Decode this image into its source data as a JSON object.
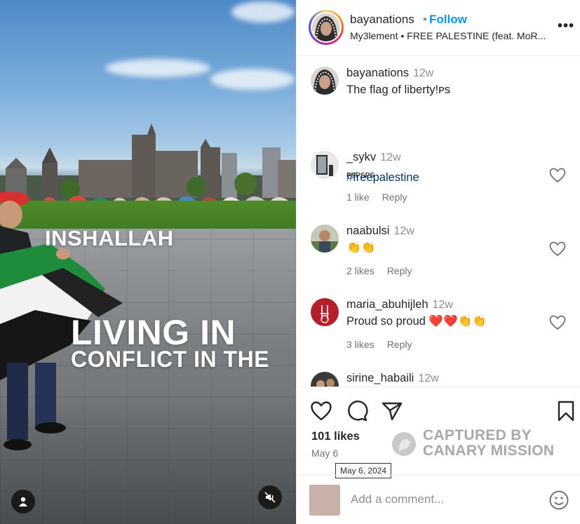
{
  "post": {
    "username": "bayanations",
    "follow_label": "Follow",
    "separator": "•",
    "audio": "My3lement • FREE PALESTINE (feat. MoR...",
    "more_label": "•••"
  },
  "media": {
    "overlay_line1": "INSHALLAH",
    "overlay_line2": "LIVING IN",
    "overlay_line3": "CONFLICT IN THE"
  },
  "caption": {
    "username": "bayanations",
    "time": "12w",
    "text": "The flag of liberty!ᴘs",
    "hashtag": "#freepalestine"
  },
  "comments": [
    {
      "username": "_sykv",
      "time": "12w",
      "text": "ᴘsᴘsᴘs",
      "likes": "1 like",
      "reply": "Reply"
    },
    {
      "username": "naabulsi",
      "time": "12w",
      "text": "👏👏",
      "likes": "2 likes",
      "reply": "Reply"
    },
    {
      "username": "maria_abuhijleh",
      "time": "12w",
      "text": "Proud so proud ❤️❤️👏👏",
      "likes": "3 likes",
      "reply": "Reply"
    },
    {
      "username": "sirine_habaili",
      "time": "12w"
    }
  ],
  "footer": {
    "likes": "101 likes",
    "date": "May 6",
    "tooltip": "May 6, 2024",
    "watermark_line1": "CAPTURED BY",
    "watermark_line2": "CANARY MISSION",
    "add_comment_placeholder": "Add a comment..."
  },
  "colors": {
    "follow": "#0095f6",
    "hashtag": "#00376b",
    "muted": "#737373"
  }
}
